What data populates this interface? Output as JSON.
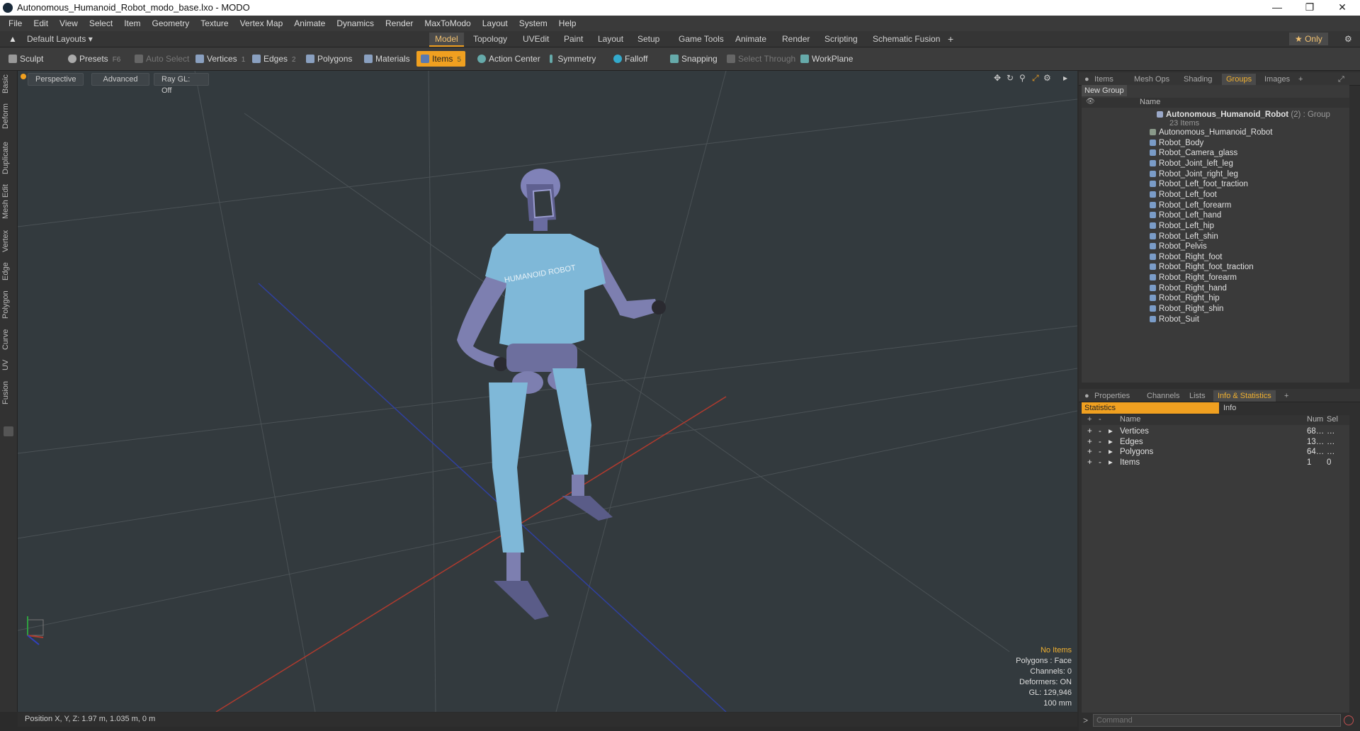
{
  "window": {
    "title": "Autonomous_Humanoid_Robot_modo_base.lxo - MODO"
  },
  "menu": [
    "File",
    "Edit",
    "View",
    "Select",
    "Item",
    "Geometry",
    "Texture",
    "Vertex Map",
    "Animate",
    "Dynamics",
    "Render",
    "MaxToModo",
    "Layout",
    "System",
    "Help"
  ],
  "layouts": {
    "preset": "Default Layouts",
    "tabs": [
      "Model",
      "Topology",
      "UVEdit",
      "Paint",
      "Layout",
      "Setup",
      "Game Tools",
      "Animate",
      "Render",
      "Scripting",
      "Schematic Fusion"
    ],
    "active": "Model",
    "only_label": "Only"
  },
  "toolbar": {
    "sculpt": "Sculpt",
    "presets": "Presets",
    "presets_key": "F6",
    "auto_select": "Auto Select",
    "vertices": "Vertices",
    "vertices_count": "1",
    "edges": "Edges",
    "edges_count": "2",
    "polygons": "Polygons",
    "materials": "Materials",
    "items": "Items",
    "items_count": "5",
    "action_center": "Action Center",
    "symmetry": "Symmetry",
    "falloff": "Falloff",
    "snapping": "Snapping",
    "select_through": "Select Through",
    "workplane": "WorkPlane"
  },
  "side_tabs": [
    "Basic",
    "Deform",
    "Duplicate",
    "Mesh Edit",
    "Vertex",
    "Edge",
    "Polygon",
    "Curve",
    "UV",
    "Fusion"
  ],
  "viewport": {
    "view": "Perspective",
    "mode": "Advanced",
    "raygl": "Ray GL: Off",
    "info": {
      "no_items": "No Items",
      "polygons": "Polygons : Face",
      "channels": "Channels: 0",
      "deformers": "Deformers: ON",
      "gl": "GL: 129,946",
      "scale": "100 mm"
    },
    "shirt_text": "HUMANOID ROBOT"
  },
  "status": {
    "position": "Position X, Y, Z:   1.97 m, 1.035 m, 0 m"
  },
  "groups_panel": {
    "tabs": [
      "Items",
      "Mesh Ops",
      "Shading",
      "Groups",
      "Images"
    ],
    "active": "Groups",
    "new_group": "New Group",
    "col_name": "Name",
    "group_name": "Autonomous_Humanoid_Robot",
    "group_suffix": "(2) : Group",
    "group_count": "23 Items",
    "items": [
      "Autonomous_Humanoid_Robot",
      "Robot_Body",
      "Robot_Camera_glass",
      "Robot_Joint_left_leg",
      "Robot_Joint_right_leg",
      "Robot_Left_foot_traction",
      "Robot_Left_foot",
      "Robot_Left_forearm",
      "Robot_Left_hand",
      "Robot_Left_hip",
      "Robot_Left_shin",
      "Robot_Pelvis",
      "Robot_Right_foot",
      "Robot_Right_foot_traction",
      "Robot_Right_forearm",
      "Robot_Right_hand",
      "Robot_Right_hip",
      "Robot_Right_shin",
      "Robot_Suit"
    ]
  },
  "stats_panel": {
    "tabs": [
      "Properties",
      "Channels",
      "Lists",
      "Info & Statistics"
    ],
    "active": "Info & Statistics",
    "sub_tabs": [
      "Statistics",
      "Info"
    ],
    "columns": [
      "Name",
      "Num",
      "Sel"
    ],
    "rows": [
      {
        "name": "Vertices",
        "num": "68…",
        "sel": "…"
      },
      {
        "name": "Edges",
        "num": "13…",
        "sel": "…"
      },
      {
        "name": "Polygons",
        "num": "64…",
        "sel": "…"
      },
      {
        "name": "Items",
        "num": "1",
        "sel": "0"
      }
    ]
  },
  "command": {
    "placeholder": "Command"
  },
  "colors": {
    "accent": "#f0a020",
    "suit": "#7fb8d8",
    "robot": "#7d7fb0",
    "viewport_bg": "#333a3e"
  }
}
